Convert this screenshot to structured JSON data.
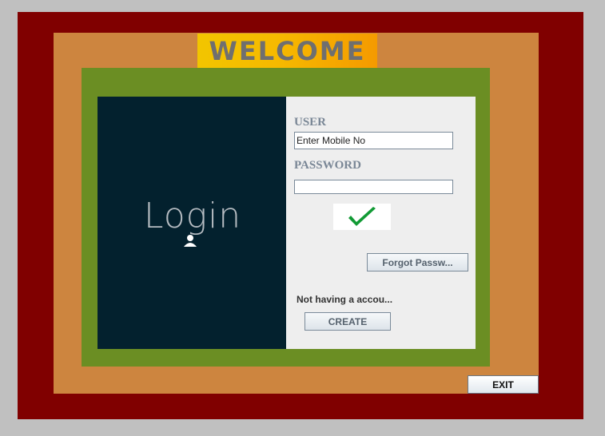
{
  "header": {
    "title": "WELCOME"
  },
  "branding": {
    "logo_text": "Login"
  },
  "form": {
    "user_label": "USER",
    "user_value": "Enter Mobile No",
    "password_label": "PASSWORD",
    "password_value": "",
    "confirm_icon": "checkmark-icon"
  },
  "actions": {
    "forgot_label": "Forgot Passw...",
    "signup_prompt": "Not having a accou...",
    "create_label": "CREATE",
    "exit_label": "EXIT"
  },
  "colors": {
    "background": "#c0c0c0",
    "outer_frame": "#800000",
    "inner_frame": "#cd853f",
    "welcome_banner": "#f4b400",
    "green_frame": "#6b8e23",
    "dark_panel": "#03212e",
    "form_panel": "#eeeeee",
    "checkmark": "#119a34"
  }
}
